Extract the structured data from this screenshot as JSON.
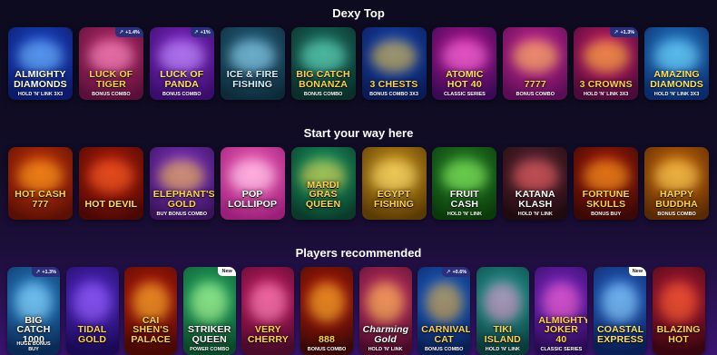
{
  "sections": [
    {
      "title": "Dexy Top",
      "games": [
        {
          "name": "ALMIGHTY DIAMONDS",
          "sub": "HOLD 'N' LINK 3x3",
          "bg": "#1f4fd6",
          "bg2": "#0b1a6a",
          "glow": "#7ec8ff",
          "text": "#ffffff",
          "badge": ""
        },
        {
          "name": "LUCK OF TIGER",
          "sub": "BONUS COMBO",
          "bg": "#c2306e",
          "bg2": "#5a0f3a",
          "glow": "#ff9cd0",
          "text": "#ffd34d",
          "badge": "+1.4%"
        },
        {
          "name": "LUCK OF PANDA",
          "sub": "BONUS COMBO",
          "bg": "#8a2bd6",
          "bg2": "#3a0d6a",
          "glow": "#c9a4ff",
          "text": "#ffe066",
          "badge": "+1%"
        },
        {
          "name": "ICE & FIRE FISHING",
          "sub": "",
          "bg": "#2b6a8a",
          "bg2": "#0d2a3a",
          "glow": "#9fe3ff",
          "text": "#d8f3ff",
          "badge": ""
        },
        {
          "name": "BIG CATCH BONANZA",
          "sub": "BONUS COMBO",
          "bg": "#1e7a6a",
          "bg2": "#0a2f2a",
          "glow": "#6fe6c8",
          "text": "#ffd34d",
          "badge": ""
        },
        {
          "name": "3 CHESTS",
          "sub": "BONUS COMBO 3x3",
          "bg": "#1b4fc2",
          "bg2": "#0a1a55",
          "glow": "#ffcc33",
          "text": "#ffd34d",
          "badge": ""
        },
        {
          "name": "ATOMIC HOT 40",
          "sub": "CLASSIC SERIES",
          "bg": "#c2189a",
          "bg2": "#3a0a55",
          "glow": "#ff7de0",
          "text": "#ffe066",
          "badge": ""
        },
        {
          "name": "7777",
          "sub": "BONUS COMBO",
          "bg": "#d62b9a",
          "bg2": "#5a0d55",
          "glow": "#ffd34d",
          "text": "#ffd34d",
          "badge": ""
        },
        {
          "name": "3 CROWNS",
          "sub": "HOLD 'N' LINK 3x3",
          "bg": "#d6206a",
          "bg2": "#4a0a3a",
          "glow": "#ffcc33",
          "text": "#ffd34d",
          "badge": "+1.3%"
        },
        {
          "name": "AMAZING DIAMONDS",
          "sub": "HOLD 'N' LINK 3x3",
          "bg": "#2b8ad6",
          "bg2": "#0a2a6a",
          "glow": "#7ee0ff",
          "text": "#ffe066",
          "badge": ""
        }
      ]
    },
    {
      "title": "Start your way here",
      "games": [
        {
          "name": "HOT CASH 777",
          "sub": "",
          "bg": "#d63a0a",
          "bg2": "#5a0f05",
          "glow": "#ffb020",
          "text": "#ffd34d",
          "badge": ""
        },
        {
          "name": "HOT DEVIL",
          "sub": "",
          "bg": "#c2200a",
          "bg2": "#4a0805",
          "glow": "#ff6a2b",
          "text": "#ffe066",
          "badge": ""
        },
        {
          "name": "ELEPHANT'S GOLD",
          "sub": "BUY BONUS COMBO",
          "bg": "#8a3ad6",
          "bg2": "#3a125a",
          "glow": "#ffcc33",
          "text": "#ffd34d",
          "badge": ""
        },
        {
          "name": "POP LOLLIPOP",
          "sub": "",
          "bg": "#ff6ac2",
          "bg2": "#9a1f7a",
          "glow": "#ffe3f5",
          "text": "#ffffff",
          "badge": ""
        },
        {
          "name": "MARDI GRAS QUEEN",
          "sub": "",
          "bg": "#1ea86a",
          "bg2": "#0a3a2a",
          "glow": "#ffd34d",
          "text": "#ffd34d",
          "badge": ""
        },
        {
          "name": "EGYPT FISHING",
          "sub": "",
          "bg": "#d6a020",
          "bg2": "#5a3a05",
          "glow": "#ffe680",
          "text": "#ffd34d",
          "badge": ""
        },
        {
          "name": "FRUIT CASH",
          "sub": "HOLD 'N' LINK",
          "bg": "#2b8a2b",
          "bg2": "#0a3a0a",
          "glow": "#9aff6a",
          "text": "#ffffff",
          "badge": ""
        },
        {
          "name": "KATANA KLASH",
          "sub": "HOLD 'N' LINK",
          "bg": "#6a2b3a",
          "bg2": "#1f0a10",
          "glow": "#ff6a6a",
          "text": "#ffffff",
          "badge": ""
        },
        {
          "name": "FORTUNE SKULLS",
          "sub": "BONUS BUY",
          "bg": "#b8200a",
          "bg2": "#3a0805",
          "glow": "#ffb020",
          "text": "#ffd34d",
          "badge": ""
        },
        {
          "name": "HAPPY BUDDHA",
          "sub": "BONUS COMBO",
          "bg": "#d6700a",
          "bg2": "#5a2a05",
          "glow": "#ffe066",
          "text": "#ffd34d",
          "badge": ""
        }
      ]
    },
    {
      "title": "Players recommended",
      "games": [
        {
          "name": "BIG CATCH 1000",
          "sub": "HUGE BONUS BUY",
          "bg": "#2b8ad6",
          "bg2": "#0a2a55",
          "glow": "#9fe3ff",
          "text": "#ffffff",
          "badge": "+1.3%"
        },
        {
          "name": "TIDAL GOLD",
          "sub": "",
          "bg": "#5a2bd6",
          "bg2": "#1a0a55",
          "glow": "#a06aff",
          "text": "#ffd34d",
          "badge": ""
        },
        {
          "name": "CAI SHEN'S PALACE",
          "sub": "",
          "bg": "#c2200a",
          "bg2": "#4a0805",
          "glow": "#ffcc33",
          "text": "#ffd34d",
          "badge": ""
        },
        {
          "name": "STRIKER QUEEN",
          "sub": "POWER COMBO",
          "bg": "#2bb86a",
          "bg2": "#0a4a2a",
          "glow": "#c8ff9a",
          "text": "#ffffff",
          "badge": "New"
        },
        {
          "name": "VERY CHERRY",
          "sub": "",
          "bg": "#d61f6a",
          "bg2": "#4a0a2a",
          "glow": "#ff9ac8",
          "text": "#ffd34d",
          "badge": ""
        },
        {
          "name": "888",
          "sub": "BONUS COMBO",
          "bg": "#c2200a",
          "bg2": "#3a0805",
          "glow": "#ffcc33",
          "text": "#ffd34d",
          "badge": ""
        },
        {
          "name": "Charming Gold",
          "sub": "HOLD 'N' LINK",
          "bg": "#d63a6a",
          "bg2": "#4a0a2a",
          "glow": "#ffd34d",
          "text": "#ffffff",
          "badge": ""
        },
        {
          "name": "CARNIVAL CAT",
          "sub": "BONUS COMBO",
          "bg": "#1f6ad6",
          "bg2": "#0a1f55",
          "glow": "#ffb020",
          "text": "#ffd34d",
          "badge": "+0.6%"
        },
        {
          "name": "TIKI ISLAND",
          "sub": "HOLD 'N' LINK",
          "bg": "#2ba8a0",
          "bg2": "#0a3a3a",
          "glow": "#ff8ac8",
          "text": "#ffd34d",
          "badge": ""
        },
        {
          "name": "ALMIGHTY JOKER 40",
          "sub": "CLASSIC SERIES",
          "bg": "#8a2bd6",
          "bg2": "#2a0a55",
          "glow": "#ff6ac2",
          "text": "#ffd34d",
          "badge": ""
        },
        {
          "name": "COASTAL EXPRESS",
          "sub": "",
          "bg": "#2b6ad6",
          "bg2": "#0a1f55",
          "glow": "#9fe3ff",
          "text": "#ffe066",
          "badge": "New"
        },
        {
          "name": "BLAZING HOT",
          "sub": "",
          "bg": "#c21f3a",
          "bg2": "#3a0510",
          "glow": "#ff6a2b",
          "text": "#ffd34d",
          "badge": ""
        }
      ]
    }
  ]
}
